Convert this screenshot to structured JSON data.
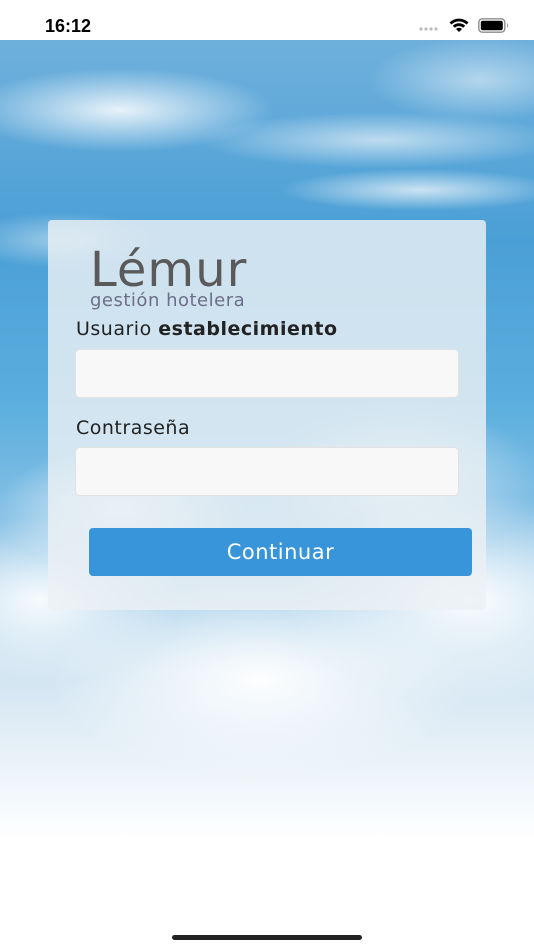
{
  "status_bar": {
    "time": "16:12",
    "icons": [
      "signal-dots-icon",
      "wifi-icon",
      "battery-icon"
    ]
  },
  "logo": {
    "main": "Lémur",
    "sub": "gestión hotelera"
  },
  "form": {
    "user_label_prefix": "Usuario",
    "user_label_bold": "establecimiento",
    "user_value": "",
    "password_label": "Contraseña",
    "password_value": "",
    "submit_label": "Continuar"
  },
  "colors": {
    "accent": "#3895da",
    "card": "#ecf0f4"
  }
}
